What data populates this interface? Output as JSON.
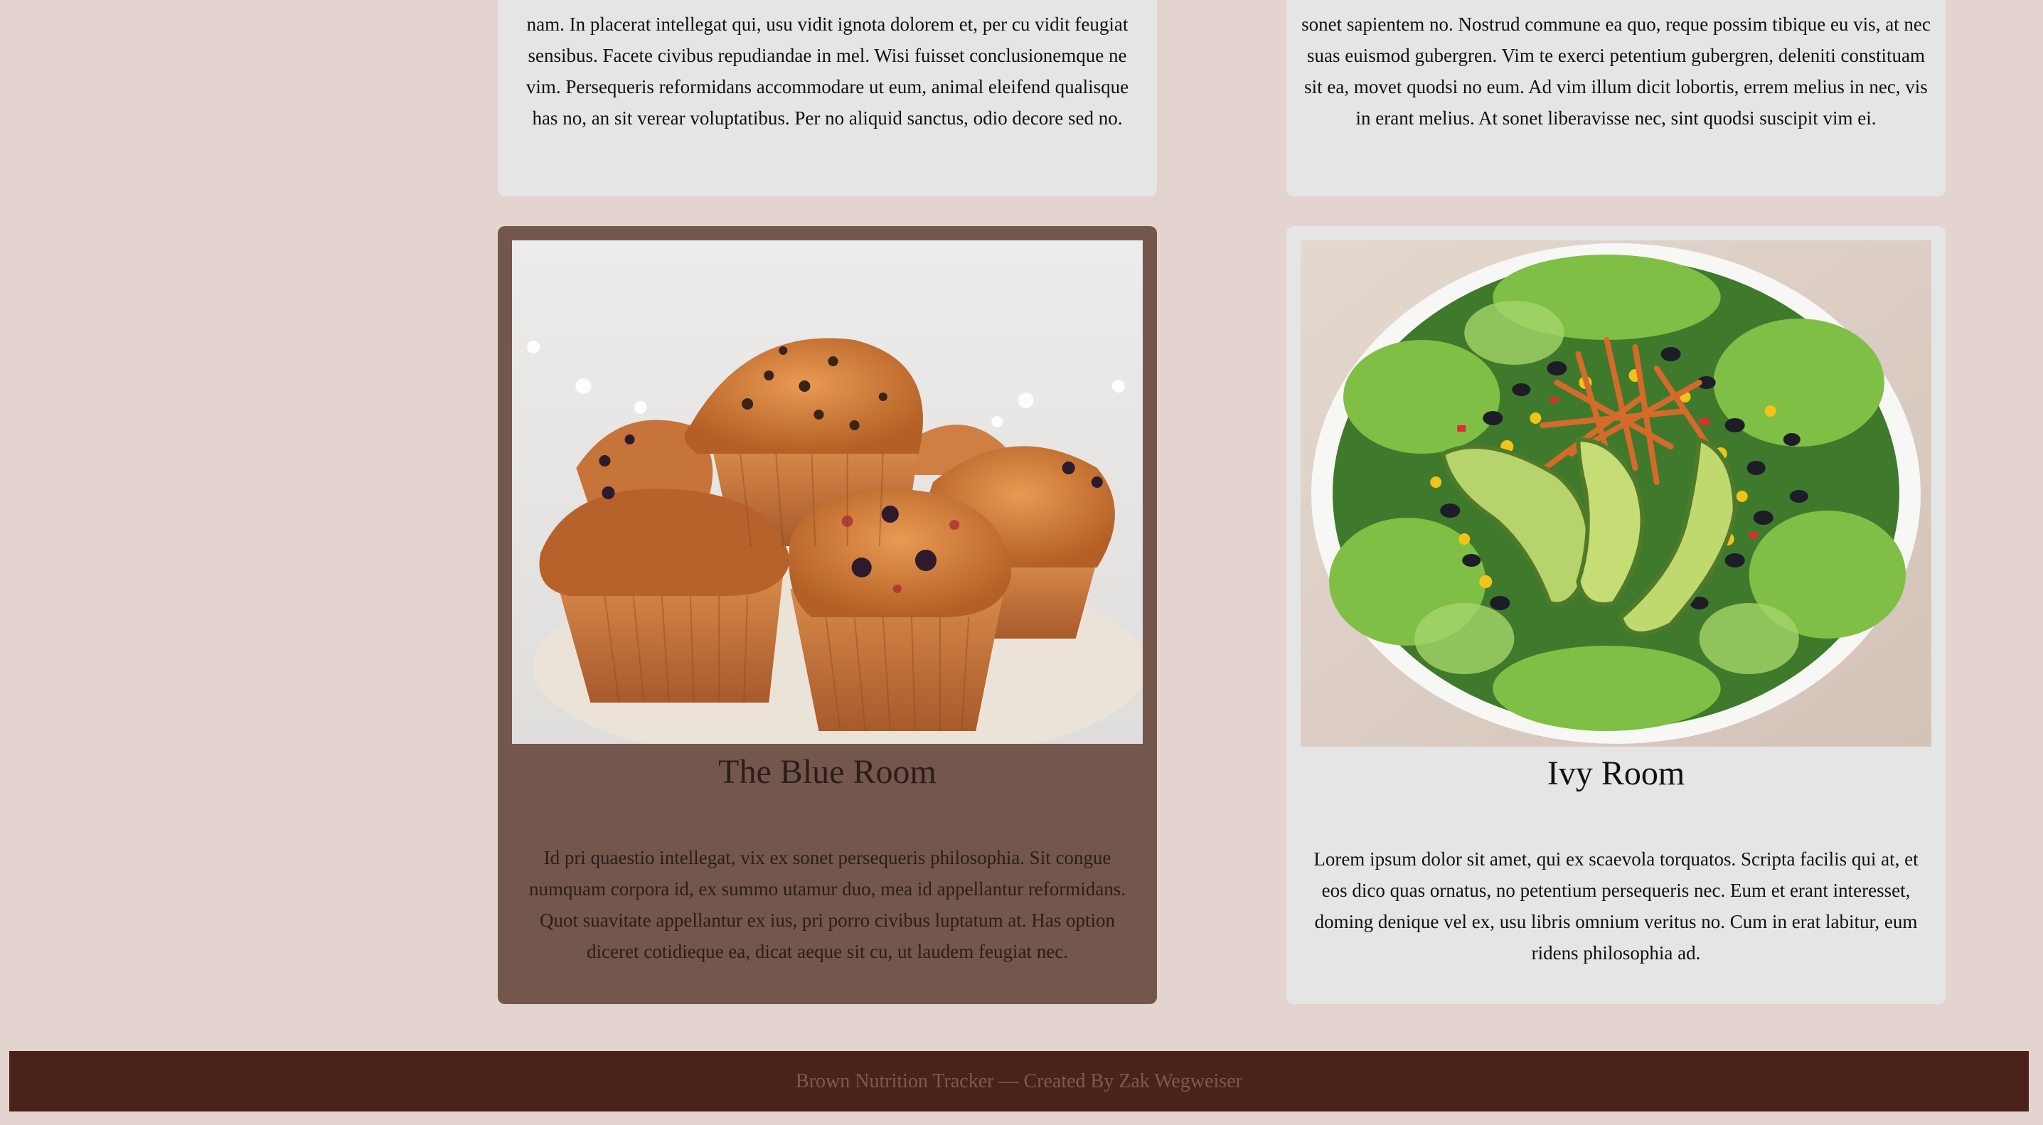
{
  "cards": {
    "top_left": {
      "body": "nam. In placerat intellegat qui, usu vidit ignota dolorem et, per cu vidit feugiat sensibus. Facete civibus repudiandae in mel. Wisi fuisset conclusionemque ne vim. Persequeris reformidans accommodare ut eum, animal eleifend qualisque has no, an sit verear voluptatibus. Per no aliquid sanctus, odio decore sed no."
    },
    "top_right": {
      "body": "sonet sapientem no. Nostrud commune ea quo, reque possim tibique eu vis, at nec suas euismod gubergren. Vim te exerci petentium gubergren, deleniti constituam sit ea, movet quodsi no eum. Ad vim illum dicit lobortis, errem melius in nec, vis in erant melius. At sonet liberavisse nec, sint quodsi suscipit vim ei."
    },
    "blue_room": {
      "title": "The Blue Room",
      "image": "muffins-photo",
      "body": "Id pri quaestio intellegat, vix ex sonet persequeris philosophia. Sit congue numquam corpora id, ex summo utamur duo, mea id appellantur reformidans. Quot suavitate appellantur ex ius, pri porro civibus luptatum at. Has option diceret cotidieque ea, dicat aeque sit cu, ut laudem feugiat nec."
    },
    "ivy_room": {
      "title": "Ivy Room",
      "image": "salad-bowl-photo",
      "body": "Lorem ipsum dolor sit amet, qui ex scaevola torquatos. Scripta facilis qui at, et eos dico quas ornatus, no petentium persequeris nec. Eum et erant interesset, doming denique vel ex, usu libris omnium veritus no. Cum in erat labitur, eum ridens philosophia ad."
    }
  },
  "footer": {
    "text": "Brown Nutrition Tracker — Created By Zak Wegweiser"
  },
  "colors": {
    "page_background": "#e3d4cf",
    "card_background": "#e5e5e5",
    "active_card_background": "#73574d",
    "footer_background": "#4a2219",
    "footer_text": "#7f5a4c"
  }
}
